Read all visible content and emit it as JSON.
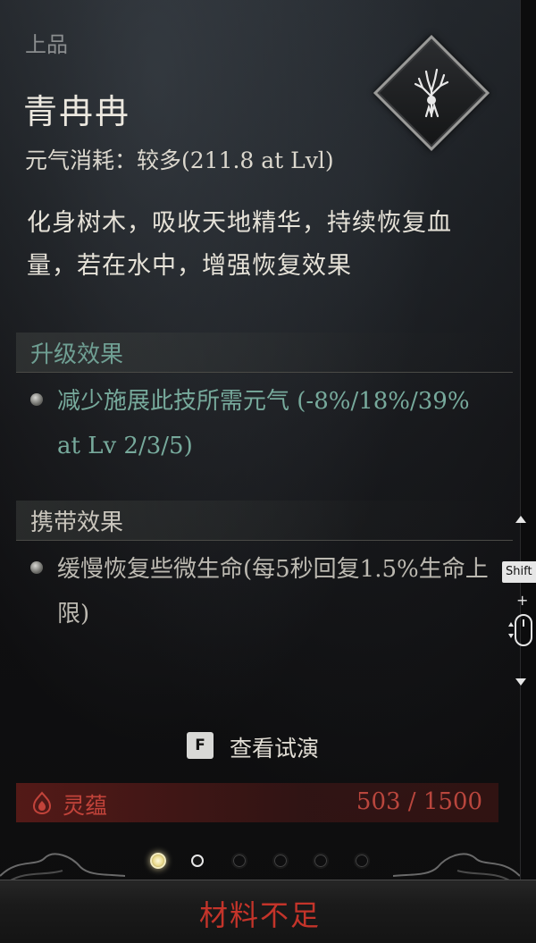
{
  "skill": {
    "grade": "上品",
    "name": "青冉冉",
    "cost": "元气消耗：较多(211.8 at Lvl)",
    "description": "化身树木，吸收天地精华，持续恢复血量，若在水中，增强恢复效果"
  },
  "upgrade": {
    "heading": "升级效果",
    "text": "减少施展此技所需元气 (-8%/18%/39% at Lv 2/3/5)"
  },
  "carry": {
    "heading": "携带效果",
    "text": "缓慢恢复些微生命(每5秒回复1.5%生命上限)"
  },
  "preview": {
    "key": "F",
    "label": "查看试演"
  },
  "resource": {
    "name": "灵蕴",
    "count": "503 / 1500",
    "icon": "flame-icon"
  },
  "pager": {
    "count": 6,
    "active_index": 0
  },
  "action": {
    "label": "材料不足"
  },
  "side_controls": {
    "shift_key": "Shift",
    "plus": "+"
  },
  "colors": {
    "accent_green": "#77aa9c",
    "resource_red": "#c2433a",
    "action_red": "#c4342a"
  }
}
